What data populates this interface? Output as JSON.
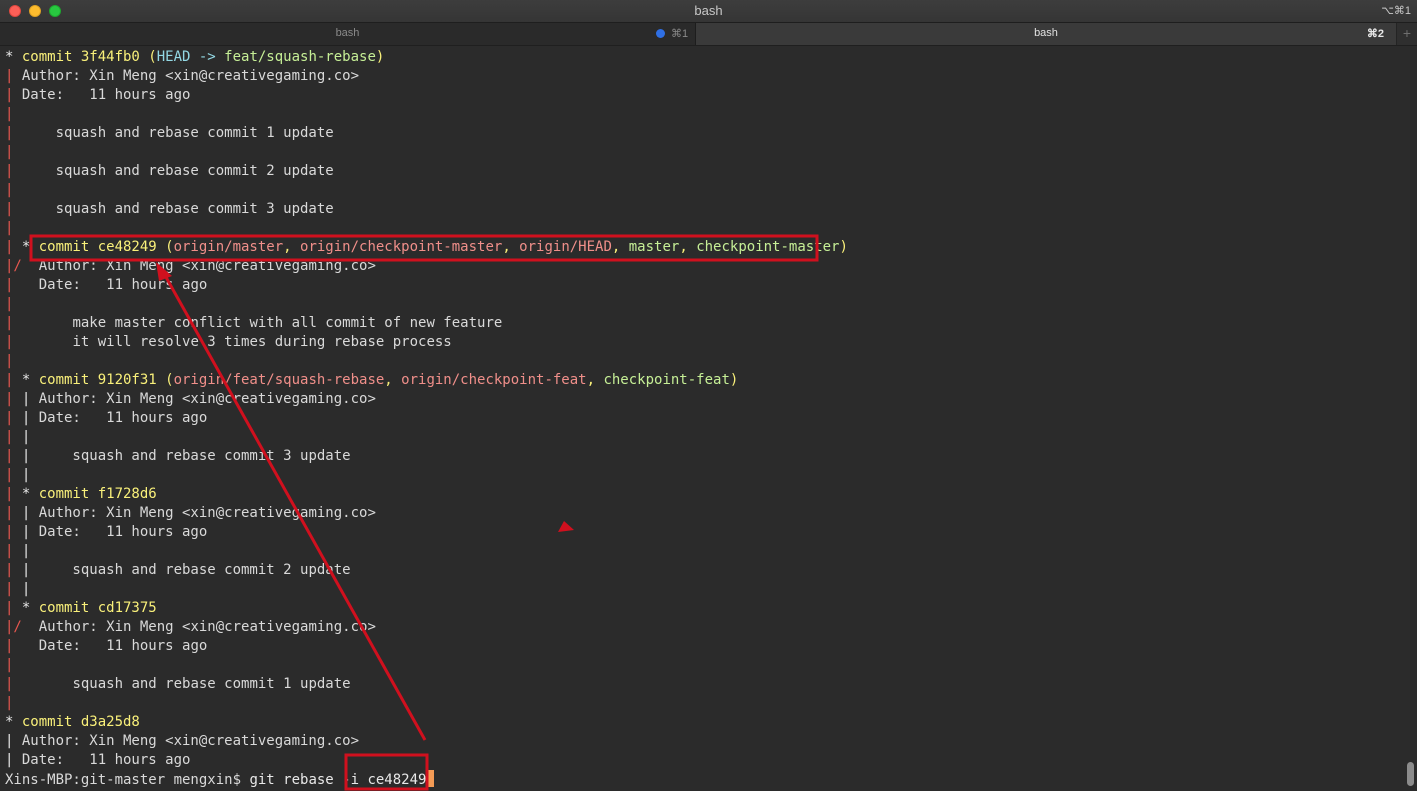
{
  "window": {
    "title": "bash",
    "shortcut": "⌥⌘1"
  },
  "tabs": [
    {
      "label": "bash",
      "shortcut": "⌘1",
      "active": false
    },
    {
      "label": "bash",
      "shortcut": "⌘2",
      "active": true
    }
  ],
  "new_tab_label": "+",
  "colors": {
    "commit_hash": "#f9f07a",
    "graph_line": "#e8574f",
    "remote_ref": "#f08f8a",
    "local_ref": "#c6ef96",
    "head": "#93d8e4",
    "cursor": "#f49b55",
    "annotation": "#d0101e"
  },
  "terminal": {
    "lines": [
      [
        {
          "t": "* ",
          "c": "w"
        },
        {
          "t": "commit 3f44fb0 (",
          "c": "y"
        },
        {
          "t": "HEAD -> ",
          "c": "c"
        },
        {
          "t": "feat/squash-rebase",
          "c": "g"
        },
        {
          "t": ")",
          "c": "y"
        }
      ],
      [
        {
          "t": "| ",
          "c": "r"
        },
        {
          "t": "Author: Xin Meng <xin@creativegaming.co>",
          "c": ""
        }
      ],
      [
        {
          "t": "| ",
          "c": "r"
        },
        {
          "t": "Date:   11 hours ago",
          "c": ""
        }
      ],
      [
        {
          "t": "|",
          "c": "r"
        }
      ],
      [
        {
          "t": "| ",
          "c": "r"
        },
        {
          "t": "    squash and rebase commit 1 update",
          "c": ""
        }
      ],
      [
        {
          "t": "|",
          "c": "r"
        }
      ],
      [
        {
          "t": "| ",
          "c": "r"
        },
        {
          "t": "    squash and rebase commit 2 update",
          "c": ""
        }
      ],
      [
        {
          "t": "|",
          "c": "r"
        }
      ],
      [
        {
          "t": "| ",
          "c": "r"
        },
        {
          "t": "    squash and rebase commit 3 update",
          "c": ""
        }
      ],
      [
        {
          "t": "|",
          "c": "r"
        }
      ],
      [
        {
          "t": "| ",
          "c": "r"
        },
        {
          "t": "* ",
          "c": "w"
        },
        {
          "t": "commit ce48249 (",
          "c": "y"
        },
        {
          "t": "origin/master",
          "c": "p"
        },
        {
          "t": ", ",
          "c": "y"
        },
        {
          "t": "origin/checkpoint-master",
          "c": "p"
        },
        {
          "t": ", ",
          "c": "y"
        },
        {
          "t": "origin/HEAD",
          "c": "p"
        },
        {
          "t": ", ",
          "c": "y"
        },
        {
          "t": "master",
          "c": "g"
        },
        {
          "t": ", ",
          "c": "y"
        },
        {
          "t": "checkpoint-master",
          "c": "g"
        },
        {
          "t": ")",
          "c": "y"
        }
      ],
      [
        {
          "t": "|/ ",
          "c": "r"
        },
        {
          "t": " Author: Xin Meng <xin@creativegaming.co>",
          "c": ""
        }
      ],
      [
        {
          "t": "|  ",
          "c": "r"
        },
        {
          "t": " Date:   11 hours ago",
          "c": ""
        }
      ],
      [
        {
          "t": "|",
          "c": "r"
        }
      ],
      [
        {
          "t": "|  ",
          "c": "r"
        },
        {
          "t": "     make master conflict with all commit of new feature",
          "c": ""
        }
      ],
      [
        {
          "t": "|  ",
          "c": "r"
        },
        {
          "t": "     it will resolve 3 times during rebase process",
          "c": ""
        }
      ],
      [
        {
          "t": "|",
          "c": "r"
        }
      ],
      [
        {
          "t": "| ",
          "c": "r"
        },
        {
          "t": "* ",
          "c": "w"
        },
        {
          "t": "commit 9120f31 (",
          "c": "y"
        },
        {
          "t": "origin/feat/squash-rebase",
          "c": "p"
        },
        {
          "t": ", ",
          "c": "y"
        },
        {
          "t": "origin/checkpoint-feat",
          "c": "p"
        },
        {
          "t": ", ",
          "c": "y"
        },
        {
          "t": "checkpoint-feat",
          "c": "g"
        },
        {
          "t": ")",
          "c": "y"
        }
      ],
      [
        {
          "t": "| ",
          "c": "r"
        },
        {
          "t": "| ",
          "c": "w"
        },
        {
          "t": "Author: Xin Meng <xin@creativegaming.co>",
          "c": ""
        }
      ],
      [
        {
          "t": "| ",
          "c": "r"
        },
        {
          "t": "| ",
          "c": "w"
        },
        {
          "t": "Date:   11 hours ago",
          "c": ""
        }
      ],
      [
        {
          "t": "| ",
          "c": "r"
        },
        {
          "t": "|",
          "c": "w"
        }
      ],
      [
        {
          "t": "| ",
          "c": "r"
        },
        {
          "t": "| ",
          "c": "w"
        },
        {
          "t": "    squash and rebase commit 3 update",
          "c": ""
        }
      ],
      [
        {
          "t": "| ",
          "c": "r"
        },
        {
          "t": "|",
          "c": "w"
        }
      ],
      [
        {
          "t": "| ",
          "c": "r"
        },
        {
          "t": "* ",
          "c": "w"
        },
        {
          "t": "commit f1728d6",
          "c": "y"
        }
      ],
      [
        {
          "t": "| ",
          "c": "r"
        },
        {
          "t": "| ",
          "c": "w"
        },
        {
          "t": "Author: Xin Meng <xin@creativegaming.co>",
          "c": ""
        }
      ],
      [
        {
          "t": "| ",
          "c": "r"
        },
        {
          "t": "| ",
          "c": "w"
        },
        {
          "t": "Date:   11 hours ago",
          "c": ""
        }
      ],
      [
        {
          "t": "| ",
          "c": "r"
        },
        {
          "t": "|",
          "c": "w"
        }
      ],
      [
        {
          "t": "| ",
          "c": "r"
        },
        {
          "t": "| ",
          "c": "w"
        },
        {
          "t": "    squash and rebase commit 2 update",
          "c": ""
        }
      ],
      [
        {
          "t": "| ",
          "c": "r"
        },
        {
          "t": "|",
          "c": "w"
        }
      ],
      [
        {
          "t": "| ",
          "c": "r"
        },
        {
          "t": "* ",
          "c": "w"
        },
        {
          "t": "commit cd17375",
          "c": "y"
        }
      ],
      [
        {
          "t": "|/ ",
          "c": "r"
        },
        {
          "t": " Author: Xin Meng <xin@creativegaming.co>",
          "c": ""
        }
      ],
      [
        {
          "t": "|  ",
          "c": "r"
        },
        {
          "t": " Date:   11 hours ago",
          "c": ""
        }
      ],
      [
        {
          "t": "|",
          "c": "r"
        }
      ],
      [
        {
          "t": "|  ",
          "c": "r"
        },
        {
          "t": "     squash and rebase commit 1 update",
          "c": ""
        }
      ],
      [
        {
          "t": "|",
          "c": "r"
        }
      ],
      [
        {
          "t": "* ",
          "c": "w"
        },
        {
          "t": "commit d3a25d8",
          "c": "y"
        }
      ],
      [
        {
          "t": "| ",
          "c": "w"
        },
        {
          "t": "Author: Xin Meng <xin@creativegaming.co>",
          "c": ""
        }
      ],
      [
        {
          "t": "| ",
          "c": "w"
        },
        {
          "t": "Date:   11 hours ago",
          "c": ""
        }
      ]
    ],
    "prompt": "Xins-MBP:git-master mengxin$ ",
    "command": "git rebase -i ce48249"
  }
}
